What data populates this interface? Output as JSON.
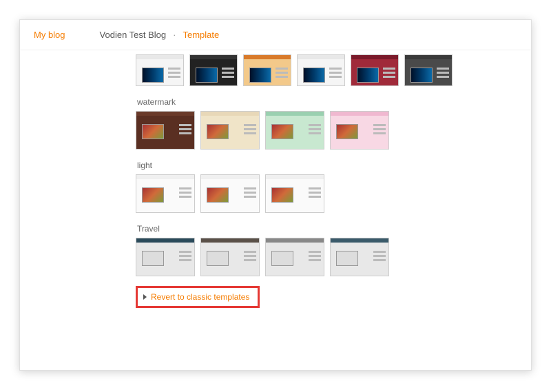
{
  "header": {
    "my_blog": "My blog",
    "blog_name": "Vodien Test Blog",
    "separator": "·",
    "page": "Template"
  },
  "categories": [
    {
      "key": "row1",
      "title": "",
      "thumbs": [
        {
          "bar": "#e8e8e8",
          "body": "#f5f5f5",
          "pic": "wave"
        },
        {
          "bar": "#333",
          "body": "#222",
          "pic": "wave"
        },
        {
          "bar": "#d87a2a",
          "body": "#f3c98a",
          "pic": "wave"
        },
        {
          "bar": "#e8e8e8",
          "body": "#f5f5f5",
          "pic": "wave"
        },
        {
          "bar": "#7a1a2a",
          "body": "#a02a3a",
          "pic": "wave"
        },
        {
          "bar": "#3a3a3a",
          "body": "#4a4a4a",
          "pic": "wave"
        }
      ]
    },
    {
      "key": "watermark",
      "title": "watermark",
      "thumbs": [
        {
          "bar": "#6a3a2a",
          "body": "#5a2f22",
          "pic": "photo"
        },
        {
          "bar": "#e8d8b8",
          "body": "#f0e4c8",
          "pic": "photo"
        },
        {
          "bar": "#9ad0b0",
          "body": "#c8e8d0",
          "pic": "photo"
        },
        {
          "bar": "#f0b8d0",
          "body": "#f8d8e4",
          "pic": "photo"
        }
      ]
    },
    {
      "key": "light",
      "title": "light",
      "thumbs": [
        {
          "bar": "#f0f0f0",
          "body": "#fafafa",
          "pic": "photo"
        },
        {
          "bar": "#f0f0f0",
          "body": "#fafafa",
          "pic": "photo"
        },
        {
          "bar": "#f0f0f0",
          "body": "#fafafa",
          "pic": "photo"
        }
      ]
    },
    {
      "key": "travel",
      "title": "Travel",
      "thumbs": [
        {
          "bar": "#2a4a5a",
          "body": "#e8e8e8",
          "pic": "mono"
        },
        {
          "bar": "#5a5048",
          "body": "#e8e8e8",
          "pic": "mono"
        },
        {
          "bar": "#888",
          "body": "#e8e8e8",
          "pic": "mono"
        },
        {
          "bar": "#3a5a6a",
          "body": "#e8e8e8",
          "pic": "mono"
        }
      ]
    }
  ],
  "revert": {
    "label": "Revert to classic templates"
  }
}
